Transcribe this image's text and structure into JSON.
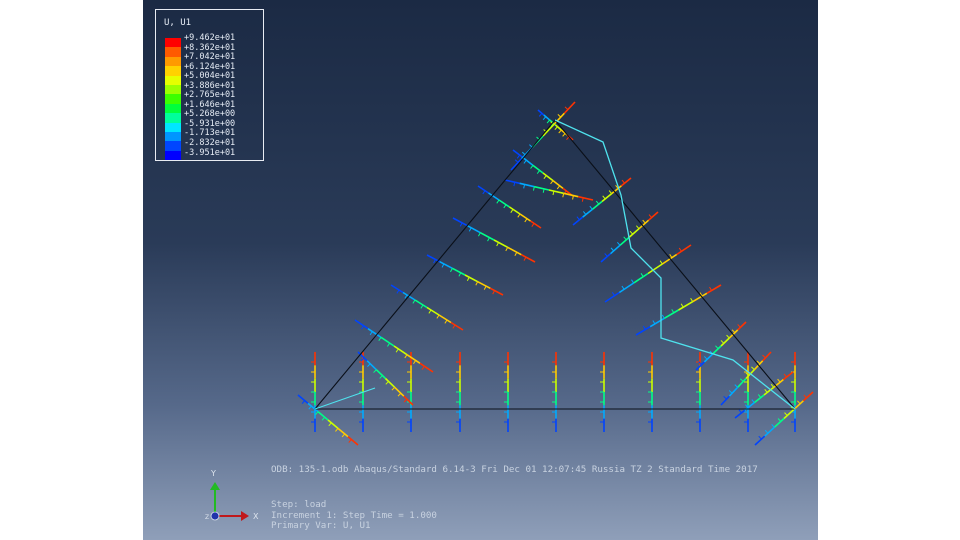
{
  "viewport": {
    "legend": {
      "title": "U, U1",
      "values": [
        "+9.462e+01",
        "+8.362e+01",
        "+7.042e+01",
        "+6.124e+01",
        "+5.004e+01",
        "+3.886e+01",
        "+2.765e+01",
        "+1.646e+01",
        "+5.268e+00",
        "-5.931e+00",
        "-1.713e+01",
        "-2.832e+01",
        "-3.951e+01"
      ],
      "colors": [
        "#ff0000",
        "#ff5a00",
        "#ff9a00",
        "#ffd200",
        "#e6ff00",
        "#9cff00",
        "#3cff00",
        "#00ff3c",
        "#00ff9a",
        "#00e6ff",
        "#0096ff",
        "#0046ff",
        "#0000ff"
      ]
    },
    "info_line": "ODB: 135-1.odb    Abaqus/Standard 6.14-3    Fri Dec 01 12:07:45 Russia TZ 2 Standard Time 2017",
    "step_lines": [
      "Step: load",
      "Increment    1: Step Time =    1.000",
      "Primary Var: U, U1"
    ],
    "triad": {
      "x_label": "X",
      "y_label": "Y",
      "z_label": "Z"
    }
  }
}
